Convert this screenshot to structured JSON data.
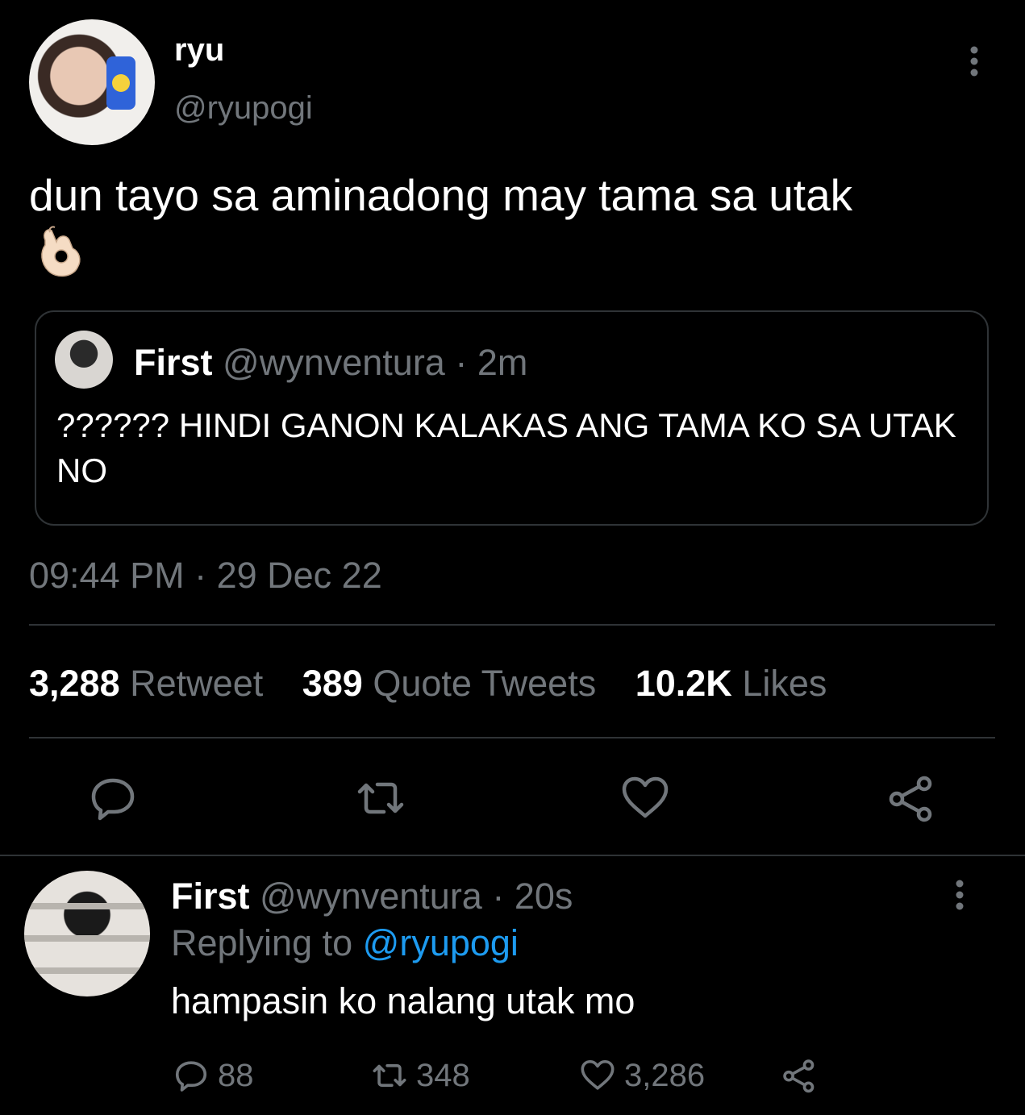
{
  "tweet": {
    "author": {
      "name": "ryu",
      "handle": "@ryupogi"
    },
    "text": "dun tayo sa aminadong may tama sa utak",
    "emoji_icon": "ok-hand-emoji",
    "quoted": {
      "name": "First",
      "meta": "@wynventura · 2m",
      "text": "?????? HINDI GANON KALAKAS ANG TAMA KO SA UTAK NO"
    },
    "timestamp": "09:44 PM · 29 Dec 22",
    "stats": {
      "retweets": {
        "value": "3,288",
        "label": "Retweet"
      },
      "quotes": {
        "value": "389",
        "label": "Quote Tweets"
      },
      "likes": {
        "value": "10.2K",
        "label": "Likes"
      }
    },
    "actions": [
      "reply-icon",
      "retweet-icon",
      "like-icon",
      "share-icon"
    ]
  },
  "reply": {
    "name": "First",
    "meta": "@wynventura · 20s",
    "replying_prefix": "Replying to",
    "replying_to": "@ryupogi",
    "text": "hampasin ko nalang utak mo",
    "counts": {
      "replies": "88",
      "retweets": "348",
      "likes": "3,286"
    }
  },
  "colors": {
    "background": "#000000",
    "text_primary": "#ffffff",
    "text_secondary": "#71767b",
    "divider": "#2f3336",
    "link": "#1d9bf0"
  }
}
